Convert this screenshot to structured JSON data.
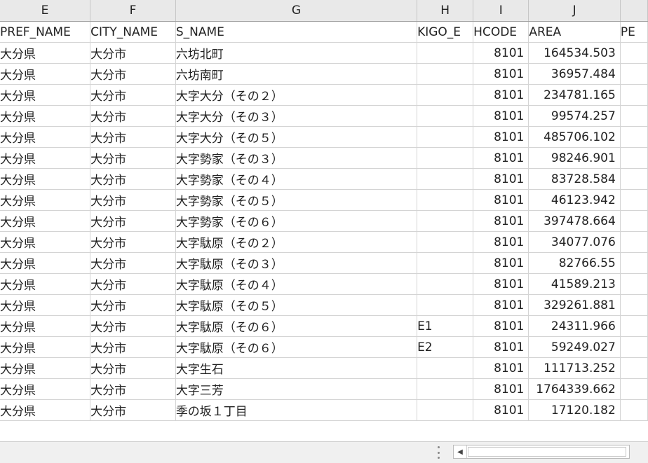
{
  "columns": [
    "E",
    "F",
    "G",
    "H",
    "I",
    "J",
    ""
  ],
  "headers": [
    "PREF_NAME",
    "CITY_NAME",
    "S_NAME",
    "KIGO_E",
    "HCODE",
    "AREA",
    "PE"
  ],
  "rows": [
    [
      "大分県",
      "大分市",
      "六坊北町",
      "",
      "8101",
      "164534.503"
    ],
    [
      "大分県",
      "大分市",
      "六坊南町",
      "",
      "8101",
      "36957.484"
    ],
    [
      "大分県",
      "大分市",
      "大字大分（その２）",
      "",
      "8101",
      "234781.165"
    ],
    [
      "大分県",
      "大分市",
      "大字大分（その３）",
      "",
      "8101",
      "99574.257"
    ],
    [
      "大分県",
      "大分市",
      "大字大分（その５）",
      "",
      "8101",
      "485706.102"
    ],
    [
      "大分県",
      "大分市",
      "大字勢家（その３）",
      "",
      "8101",
      "98246.901"
    ],
    [
      "大分県",
      "大分市",
      "大字勢家（その４）",
      "",
      "8101",
      "83728.584"
    ],
    [
      "大分県",
      "大分市",
      "大字勢家（その５）",
      "",
      "8101",
      "46123.942"
    ],
    [
      "大分県",
      "大分市",
      "大字勢家（その６）",
      "",
      "8101",
      "397478.664"
    ],
    [
      "大分県",
      "大分市",
      "大字駄原（その２）",
      "",
      "8101",
      "34077.076"
    ],
    [
      "大分県",
      "大分市",
      "大字駄原（その３）",
      "",
      "8101",
      "82766.55"
    ],
    [
      "大分県",
      "大分市",
      "大字駄原（その４）",
      "",
      "8101",
      "41589.213"
    ],
    [
      "大分県",
      "大分市",
      "大字駄原（その５）",
      "",
      "8101",
      "329261.881"
    ],
    [
      "大分県",
      "大分市",
      "大字駄原（その６）",
      "E1",
      "8101",
      "24311.966"
    ],
    [
      "大分県",
      "大分市",
      "大字駄原（その６）",
      "E2",
      "8101",
      "59249.027"
    ],
    [
      "大分県",
      "大分市",
      "大字生石",
      "",
      "8101",
      "111713.252"
    ],
    [
      "大分県",
      "大分市",
      "大字三芳",
      "",
      "8101",
      "1764339.662"
    ],
    [
      "大分県",
      "大分市",
      "季の坂１丁目",
      "",
      "8101",
      "17120.182"
    ]
  ]
}
